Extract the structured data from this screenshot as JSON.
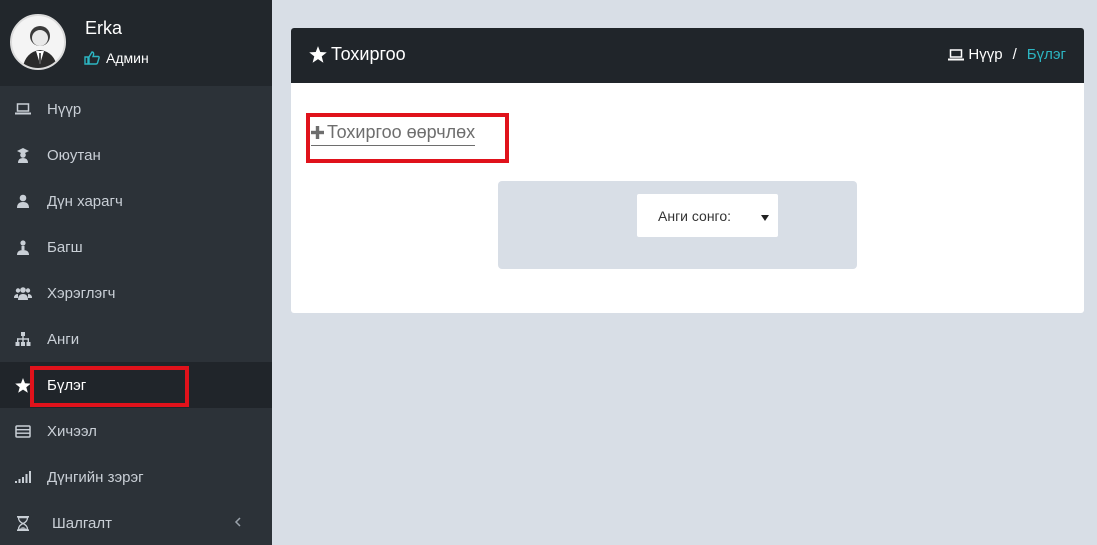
{
  "profile": {
    "name": "Erka",
    "role": "Админ"
  },
  "sidebar": {
    "items": [
      {
        "label": "Нүүр",
        "icon": "laptop-icon"
      },
      {
        "label": "Оюутан",
        "icon": "graduate-icon"
      },
      {
        "label": "Дүн харагч",
        "icon": "user-icon"
      },
      {
        "label": "Багш",
        "icon": "teacher-icon"
      },
      {
        "label": "Хэрэглэгч",
        "icon": "users-icon"
      },
      {
        "label": "Анги",
        "icon": "sitemap-icon"
      },
      {
        "label": "Бүлэг",
        "icon": "star-icon",
        "active": true
      },
      {
        "label": "Хичээл",
        "icon": "book-icon"
      },
      {
        "label": "Дүнгийн зэрэг",
        "icon": "signal-icon"
      },
      {
        "label": "Шалгалт",
        "icon": "hourglass-icon"
      }
    ]
  },
  "panel": {
    "title": "Тохиргоо",
    "breadcrumb": {
      "home": "Нүүр",
      "separator": "/",
      "current": "Бүлэг"
    },
    "change_link": "Тохиргоо өөрчлөх",
    "class_select": {
      "selected": "Анги сонго:"
    }
  },
  "colors": {
    "accent": "#2cb5c2",
    "highlight": "#e0121b",
    "sidebar_bg": "#2c3238",
    "header_bg": "#20252a"
  }
}
